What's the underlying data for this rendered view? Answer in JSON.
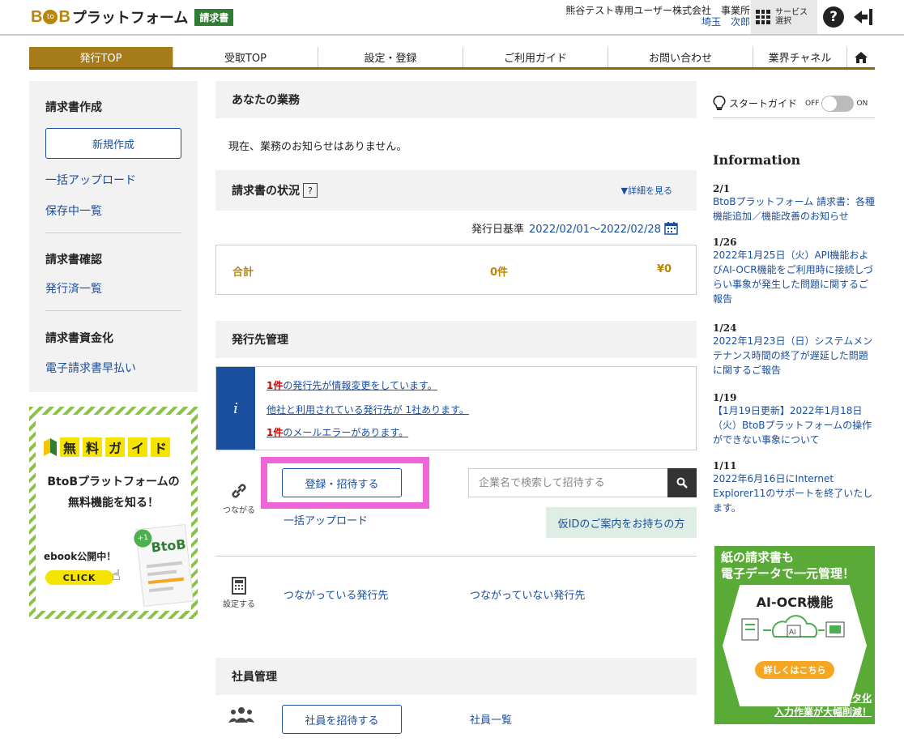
{
  "header": {
    "logo_b1": "B",
    "logo_to": "to",
    "logo_b2": "B",
    "logo_text": "プラットフォーム",
    "logo_badge": "請求書",
    "company": "熊谷テスト専用ユーザー株式会社",
    "office_label": "事業所",
    "office_name": "埼玉",
    "user_name": "次郎",
    "service_label_1": "サービス",
    "service_label_2": "選択"
  },
  "nav": {
    "items": [
      "発行TOP",
      "受取TOP",
      "設定・登録",
      "ご利用ガイド",
      "お問い合わせ",
      "業界チャネル"
    ]
  },
  "sidebar": {
    "invoice_create": "請求書作成",
    "new_button": "新規作成",
    "bulk_upload": "一括アップロード",
    "saved_list": "保存中一覧",
    "invoice_confirm": "請求書確認",
    "issued_list": "発行済一覧",
    "invoice_funding": "請求書資金化",
    "early_payment": "電子請求書早払い"
  },
  "guide": {
    "chars": [
      "無",
      "料",
      "ガ",
      "イ",
      "ド"
    ],
    "line1": "BtoBプラットフォームの",
    "line2": "無料機能を知る！",
    "ebook": "ebook公開中！",
    "click": "CLICK",
    "book_plus": "+1",
    "book_title": "BtoB"
  },
  "main": {
    "your_work": "あなたの業務",
    "no_notice": "現在、業務のお知らせはありません。",
    "invoice_status": "請求書の状況",
    "qmark": "?",
    "detail": "▼詳細を見る",
    "date_label": "発行日基準",
    "date_range": "2022/02/01～2022/02/28",
    "total_label": "合計",
    "total_count": "0件",
    "total_amount": "¥0",
    "issuer_mgmt": "発行先管理",
    "info_i": "i",
    "notice1_count": "1件",
    "notice1_text": "の発行先が情報変更をしています。",
    "notice2_text": "他社と利用されている発行先が 1社あります。",
    "notice3_count": "1件",
    "notice3_text": "のメールエラーがあります。",
    "register_invite": "登録・招待する",
    "search_placeholder": "企業名で検索して招待する",
    "connect_label": "つながる",
    "bulk_upload": "一括アップロード",
    "temp_id": "仮IDのご案内をお持ちの方",
    "setting_label": "設定する",
    "connected": "つながっている発行先",
    "not_connected": "つながっていない発行先",
    "staff_mgmt": "社員管理",
    "invite_staff": "社員を招待する",
    "staff_list": "社員一覧"
  },
  "right": {
    "start_guide": "スタートガイド",
    "toggle_off": "OFF",
    "toggle_on": "ON",
    "info_title": "Information",
    "news": [
      {
        "date": "2/1",
        "text": "BtoBプラットフォーム 請求書：各種機能追加／機能改善のお知らせ"
      },
      {
        "date": "1/26",
        "text": "2022年1月25日（火）API機能およびAI-OCR機能をご利用時に接続しづらい事象が発生した問題に関するご報告"
      },
      {
        "date": "1/24",
        "text": "2022年1月23日（日）システムメンテナンス時間の終了が遅延した問題に関するご報告"
      },
      {
        "date": "1/19",
        "text": "【1月19日更新】2022年1月18日（火）BtoBプラットフォームの操作ができない事象について"
      },
      {
        "date": "1/11",
        "text": "2022年6月16日にInternet Explorer11のサポートを終了いたします。"
      }
    ],
    "ocr_line1": "紙の請求書も",
    "ocr_line2": "電子データで一元管理！",
    "ocr_title": "AI-OCR機能",
    "ocr_ai": "AI",
    "ocr_pill": "詳しくはこちら",
    "ocr_bottom1": "簡単・素早く電子データ化",
    "ocr_bottom2": "入力作業が大幅削減！"
  }
}
